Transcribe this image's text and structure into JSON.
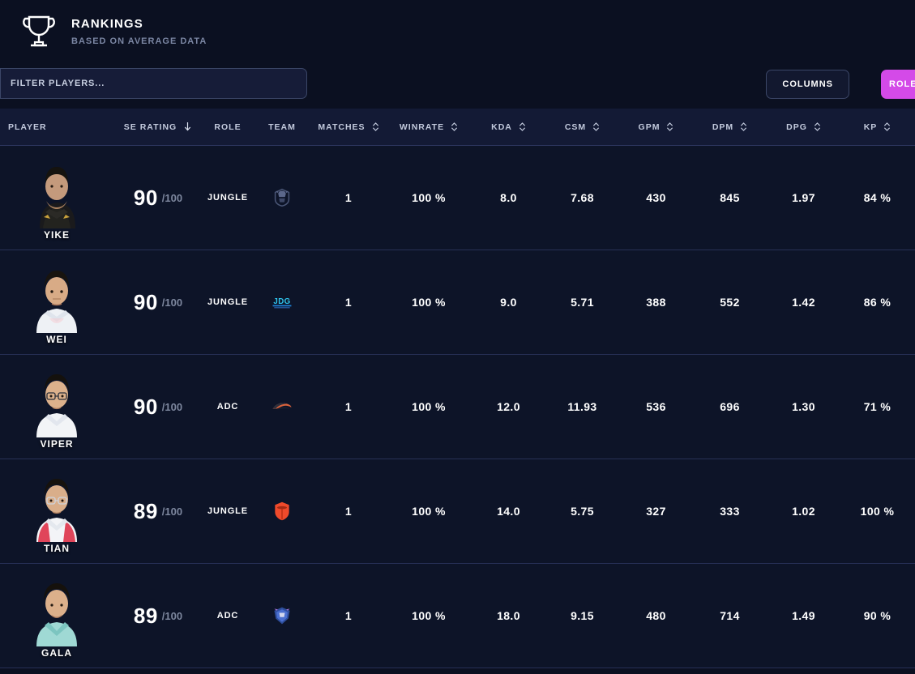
{
  "header": {
    "icon": "trophy-icon",
    "title": "RANKINGS",
    "subtitle": "BASED ON AVERAGE DATA"
  },
  "toolbar": {
    "filter_placeholder": "FILTER PLAYERS...",
    "filter_value": "",
    "columns_label": "COLUMNS",
    "role_label": "ROLE",
    "role_button_color": "#d44ae8"
  },
  "table": {
    "columns": [
      {
        "key": "player",
        "label": "PLAYER",
        "sort": "none"
      },
      {
        "key": "rating",
        "label": "SE RATING",
        "sort": "desc"
      },
      {
        "key": "role",
        "label": "ROLE",
        "sort": "none"
      },
      {
        "key": "team",
        "label": "TEAM",
        "sort": "none"
      },
      {
        "key": "matches",
        "label": "MATCHES",
        "sort": "both"
      },
      {
        "key": "winrate",
        "label": "WINRATE",
        "sort": "both"
      },
      {
        "key": "kda",
        "label": "KDA",
        "sort": "both"
      },
      {
        "key": "csm",
        "label": "CSM",
        "sort": "both"
      },
      {
        "key": "gpm",
        "label": "GPM",
        "sort": "both"
      },
      {
        "key": "dpm",
        "label": "DPM",
        "sort": "both"
      },
      {
        "key": "dpg",
        "label": "DPG",
        "sort": "both"
      },
      {
        "key": "kp",
        "label": "KP",
        "sort": "both"
      }
    ],
    "rating_suffix": "/100",
    "rows": [
      {
        "player": "YIKE",
        "rating": "90",
        "role": "JUNGLE",
        "team": "g2-logo",
        "matches": "1",
        "winrate": "100 %",
        "kda": "8.0",
        "csm": "7.68",
        "gpm": "430",
        "dpm": "845",
        "dpg": "1.97",
        "kp": "84 %"
      },
      {
        "player": "WEI",
        "rating": "90",
        "role": "JUNGLE",
        "team": "jdg-logo",
        "matches": "1",
        "winrate": "100 %",
        "kda": "9.0",
        "csm": "5.71",
        "gpm": "388",
        "dpm": "552",
        "dpg": "1.42",
        "kp": "86 %"
      },
      {
        "player": "VIPER",
        "rating": "90",
        "role": "ADC",
        "team": "hle-logo",
        "matches": "1",
        "winrate": "100 %",
        "kda": "12.0",
        "csm": "11.93",
        "gpm": "536",
        "dpm": "696",
        "dpg": "1.30",
        "kp": "71 %"
      },
      {
        "player": "TIAN",
        "rating": "89",
        "role": "JUNGLE",
        "team": "fpx-logo",
        "matches": "1",
        "winrate": "100 %",
        "kda": "14.0",
        "csm": "5.75",
        "gpm": "327",
        "dpm": "333",
        "dpg": "1.02",
        "kp": "100 %"
      },
      {
        "player": "GALA",
        "rating": "89",
        "role": "ADC",
        "team": "rng-logo",
        "matches": "1",
        "winrate": "100 %",
        "kda": "18.0",
        "csm": "9.15",
        "gpm": "480",
        "dpm": "714",
        "dpg": "1.49",
        "kp": "90 %"
      }
    ]
  }
}
